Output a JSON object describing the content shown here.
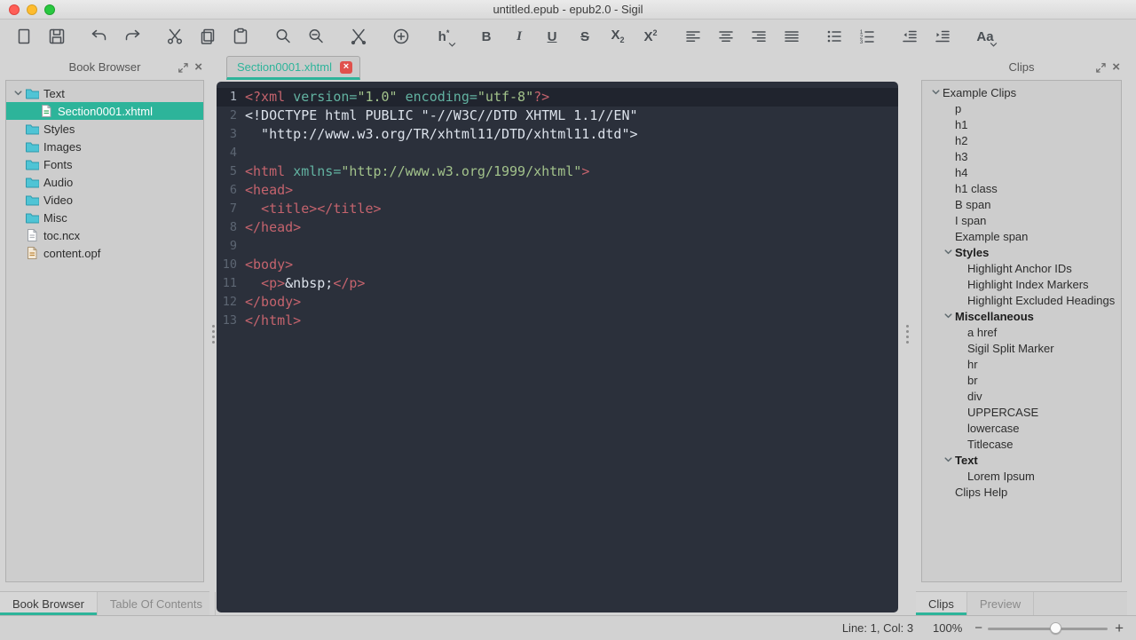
{
  "window": {
    "title": "untitled.epub - epub2.0 - Sigil"
  },
  "colors": {
    "accent": "#2db49a",
    "editor_bg": "#2b303b",
    "current_line_bg": "#20242e",
    "tag": "#c4636d",
    "attribute": "#62b2a1",
    "string": "#a2c28b",
    "plain_text": "#dce2eb",
    "line_number": "#5d6673"
  },
  "toolbar": {
    "buttons": [
      {
        "name": "new-file",
        "icon": "doc"
      },
      {
        "name": "save",
        "icon": "save"
      },
      {
        "name": "undo",
        "icon": "undo",
        "gap": true
      },
      {
        "name": "redo",
        "icon": "redo"
      },
      {
        "name": "cut",
        "icon": "scissors",
        "gap": true
      },
      {
        "name": "copy",
        "icon": "copy"
      },
      {
        "name": "paste",
        "icon": "clipboard"
      },
      {
        "name": "find",
        "icon": "magnifier",
        "gap": true
      },
      {
        "name": "find-replace",
        "icon": "magnifier-minus"
      },
      {
        "name": "split-at-cursor",
        "icon": "split",
        "gap": true
      },
      {
        "name": "insert-file",
        "icon": "plus-circle",
        "gap": true
      },
      {
        "name": "heading",
        "text": "h",
        "sup": "*",
        "caret": true,
        "gap": true
      },
      {
        "name": "bold",
        "text": "B",
        "gap": true
      },
      {
        "name": "italic",
        "text": "I"
      },
      {
        "name": "underline",
        "text": "U"
      },
      {
        "name": "strikethrough",
        "text": "S"
      },
      {
        "name": "subscript",
        "text": "X",
        "sub": "2"
      },
      {
        "name": "superscript",
        "text": "X",
        "sup": "2"
      },
      {
        "name": "align-left",
        "icon": "align-left",
        "gap": true
      },
      {
        "name": "align-center",
        "icon": "align-center"
      },
      {
        "name": "align-right",
        "icon": "align-right"
      },
      {
        "name": "align-justify",
        "icon": "align-justify"
      },
      {
        "name": "bullet-list",
        "icon": "list-bullet",
        "gap": true
      },
      {
        "name": "numbered-list",
        "icon": "list-number"
      },
      {
        "name": "outdent",
        "icon": "outdent",
        "gap": true
      },
      {
        "name": "indent",
        "icon": "indent"
      },
      {
        "name": "text-case",
        "text": "Aa",
        "caret": true,
        "gap": true
      }
    ]
  },
  "book_browser": {
    "title": "Book Browser",
    "items": [
      {
        "label": "Text",
        "icon": "folder",
        "level": 0,
        "expanded": true
      },
      {
        "label": "Section0001.xhtml",
        "icon": "page-html",
        "level": 1,
        "selected": true
      },
      {
        "label": "Styles",
        "icon": "folder",
        "level": 0
      },
      {
        "label": "Images",
        "icon": "folder",
        "level": 0
      },
      {
        "label": "Fonts",
        "icon": "folder",
        "level": 0
      },
      {
        "label": "Audio",
        "icon": "folder",
        "level": 0
      },
      {
        "label": "Video",
        "icon": "folder",
        "level": 0
      },
      {
        "label": "Misc",
        "icon": "folder",
        "level": 0
      },
      {
        "label": "toc.ncx",
        "icon": "page",
        "level": 0
      },
      {
        "label": "content.opf",
        "icon": "page-opf",
        "level": 0
      }
    ],
    "tabs": [
      {
        "label": "Book Browser",
        "active": true
      },
      {
        "label": "Table Of Contents",
        "active": false
      }
    ]
  },
  "editor": {
    "tab": {
      "label": "Section0001.xhtml",
      "close_glyph": "×"
    },
    "lines": [
      {
        "n": 1,
        "current": true,
        "segs": [
          [
            "tag",
            "<?xml "
          ],
          [
            "attr",
            "version="
          ],
          [
            "str",
            "\"1.0\""
          ],
          [
            "attr",
            " encoding="
          ],
          [
            "str",
            "\"utf-8\""
          ],
          [
            "tag",
            "?>"
          ]
        ]
      },
      {
        "n": 2,
        "segs": [
          [
            "plain",
            "<!DOCTYPE html PUBLIC \"-//W3C//DTD XHTML 1.1//EN\""
          ]
        ]
      },
      {
        "n": 3,
        "segs": [
          [
            "plain",
            "  \"http://www.w3.org/TR/xhtml11/DTD/xhtml11.dtd\">"
          ]
        ]
      },
      {
        "n": 4,
        "segs": []
      },
      {
        "n": 5,
        "segs": [
          [
            "tag",
            "<html "
          ],
          [
            "attr",
            "xmlns="
          ],
          [
            "str",
            "\"http://www.w3.org/1999/xhtml\""
          ],
          [
            "tag",
            ">"
          ]
        ]
      },
      {
        "n": 6,
        "segs": [
          [
            "tag",
            "<head>"
          ]
        ]
      },
      {
        "n": 7,
        "segs": [
          [
            "plain",
            "  "
          ],
          [
            "tag",
            "<title></title>"
          ]
        ]
      },
      {
        "n": 8,
        "segs": [
          [
            "tag",
            "</head>"
          ]
        ]
      },
      {
        "n": 9,
        "segs": []
      },
      {
        "n": 10,
        "segs": [
          [
            "tag",
            "<body>"
          ]
        ]
      },
      {
        "n": 11,
        "segs": [
          [
            "plain",
            "  "
          ],
          [
            "tag",
            "<p>"
          ],
          [
            "plain",
            "&nbsp;"
          ],
          [
            "tag",
            "</p>"
          ]
        ]
      },
      {
        "n": 12,
        "segs": [
          [
            "tag",
            "</body>"
          ]
        ]
      },
      {
        "n": 13,
        "segs": [
          [
            "tag",
            "</html>"
          ]
        ]
      }
    ]
  },
  "clips": {
    "title": "Clips",
    "items": [
      {
        "label": "Example Clips",
        "level": 0,
        "chevron": true
      },
      {
        "label": "p",
        "level": 1
      },
      {
        "label": "h1",
        "level": 1
      },
      {
        "label": "h2",
        "level": 1
      },
      {
        "label": "h3",
        "level": 1
      },
      {
        "label": "h4",
        "level": 1
      },
      {
        "label": "h1 class",
        "level": 1
      },
      {
        "label": "B span",
        "level": 1
      },
      {
        "label": "I span",
        "level": 1
      },
      {
        "label": "Example span",
        "level": 1
      },
      {
        "label": "Styles",
        "level": 1,
        "chevron": true,
        "bold": true
      },
      {
        "label": "Highlight Anchor IDs",
        "level": 2
      },
      {
        "label": "Highlight Index Markers",
        "level": 2
      },
      {
        "label": "Highlight Excluded Headings",
        "level": 2
      },
      {
        "label": "Miscellaneous",
        "level": 1,
        "chevron": true,
        "bold": true
      },
      {
        "label": "a href",
        "level": 2
      },
      {
        "label": "Sigil Split Marker",
        "level": 2
      },
      {
        "label": "hr",
        "level": 2
      },
      {
        "label": "br",
        "level": 2
      },
      {
        "label": "div",
        "level": 2
      },
      {
        "label": "UPPERCASE",
        "level": 2
      },
      {
        "label": "lowercase",
        "level": 2
      },
      {
        "label": "Titlecase",
        "level": 2
      },
      {
        "label": "Text",
        "level": 1,
        "chevron": true,
        "bold": true
      },
      {
        "label": "Lorem Ipsum",
        "level": 2
      },
      {
        "label": "Clips Help",
        "level": 1
      }
    ],
    "tabs": [
      {
        "label": "Clips",
        "active": true
      },
      {
        "label": "Preview",
        "active": false
      }
    ]
  },
  "statusbar": {
    "line_col": "Line: 1, Col: 3",
    "zoom": "100%"
  }
}
